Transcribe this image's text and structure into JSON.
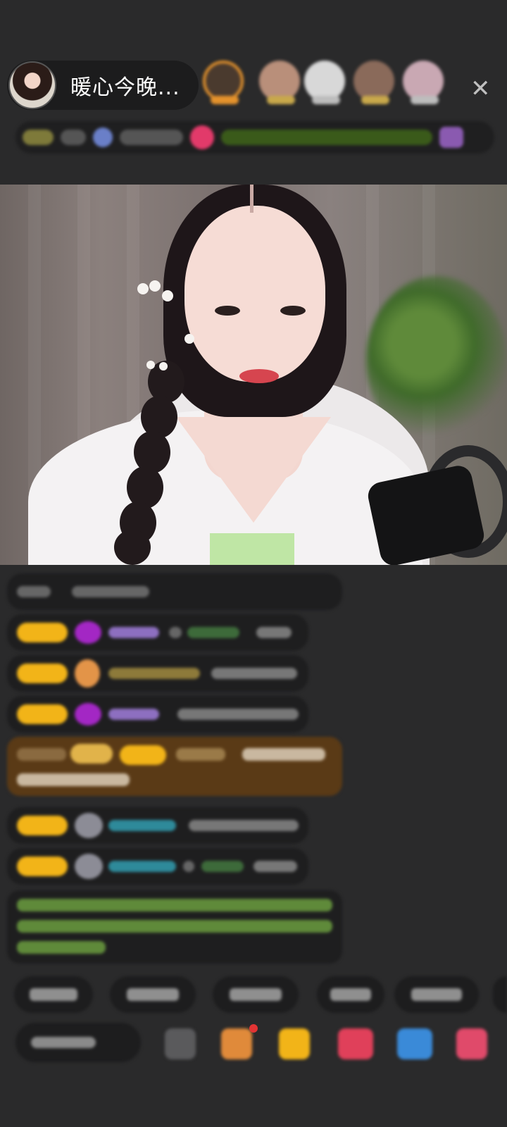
{
  "header": {
    "host_name": "暖心今晚...",
    "close_icon": "close-icon",
    "viewers": [
      {
        "name": "viewer-1",
        "ring": "#e4922c"
      },
      {
        "name": "viewer-2",
        "ring": "#cbb07a"
      },
      {
        "name": "viewer-3",
        "ring": "#d9d9d9"
      },
      {
        "name": "viewer-4",
        "ring": "#cbb07a"
      },
      {
        "name": "viewer-5",
        "ring": "#d8cfd5"
      }
    ]
  },
  "colors": {
    "background": "#2a2a2b",
    "badge_gold": "#f2b418",
    "username_purple": "#a77bd6",
    "username_teal": "#3fb6c8",
    "announcement_green": "#9bd36a",
    "highlight_brown": "#5a3a16"
  },
  "icons": [
    "close-icon",
    "purple-diamond-icon",
    "orange-pet-icon",
    "shell-icon",
    "gift-box-icon",
    "treasure-icon",
    "red-packet-icon",
    "game-icon",
    "more-apps-icon",
    "emoji-icon"
  ]
}
